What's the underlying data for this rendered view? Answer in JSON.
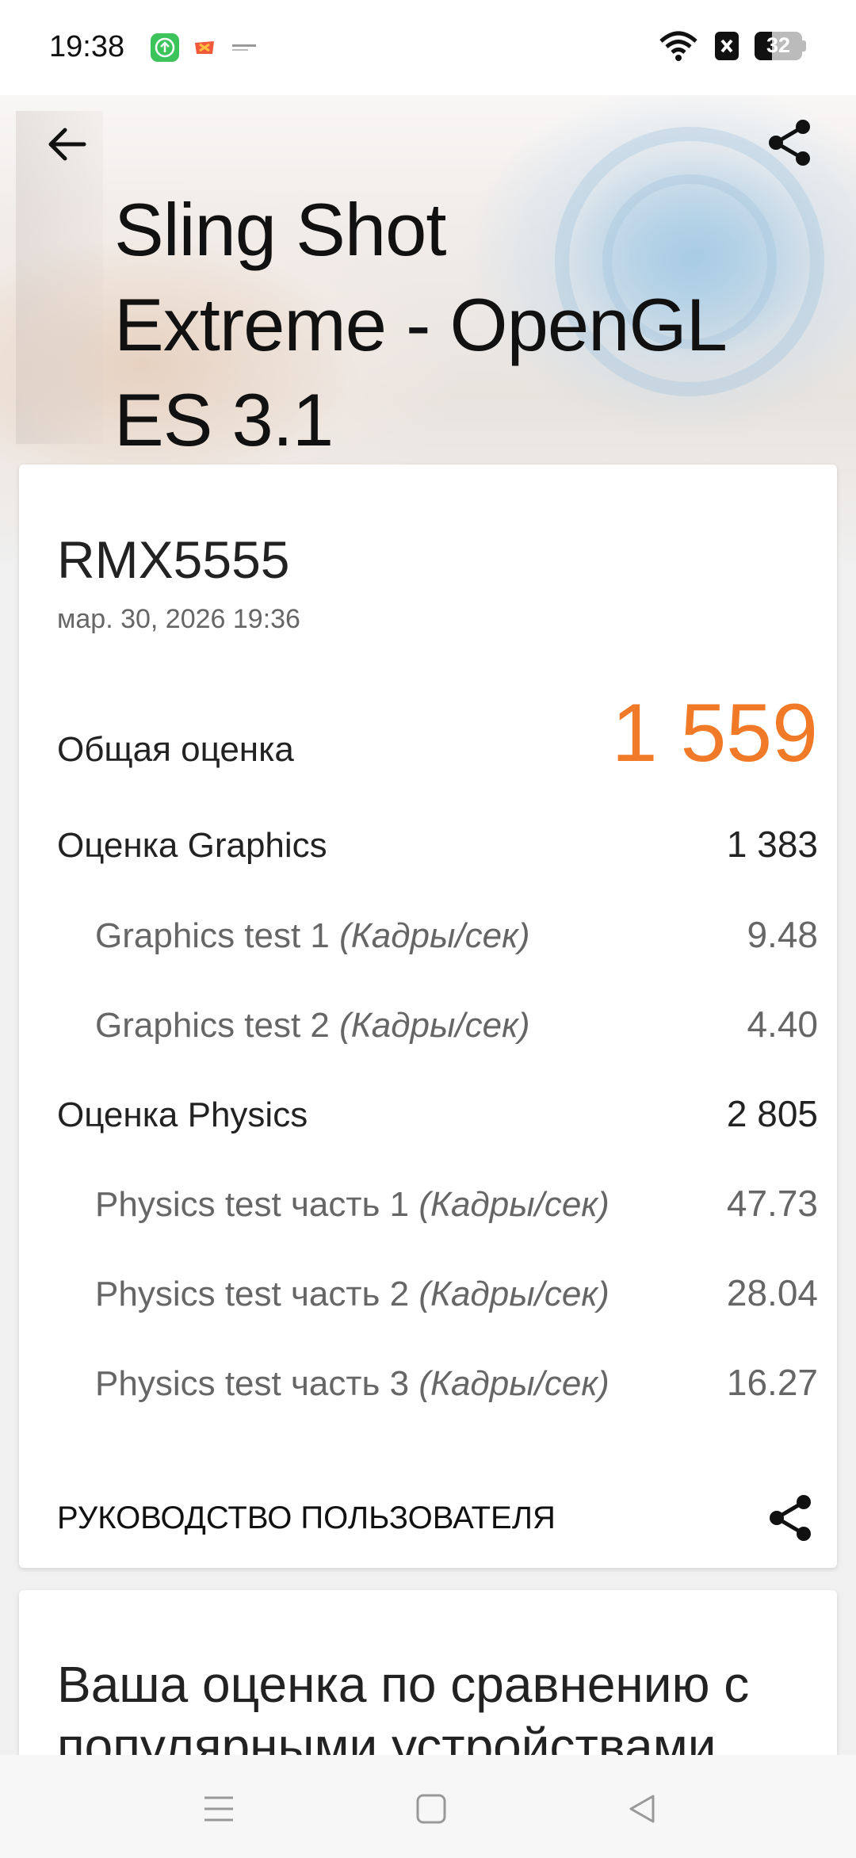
{
  "status_bar": {
    "time": "19:38",
    "battery": "32"
  },
  "header": {
    "title_line1": "Sling Shot",
    "title_line2": "Extreme - OpenGL",
    "title_line3": "ES 3.1"
  },
  "result": {
    "device": "RMX5555",
    "date": "мар. 30, 2026 19:36",
    "total_label": "Общая оценка",
    "total_value": "1 559",
    "rows": [
      {
        "label": "Оценка Graphics",
        "unit": "",
        "value": "1 383"
      },
      {
        "label": "Graphics test 1",
        "unit": "(Кадры/сек)",
        "value": "9.48"
      },
      {
        "label": "Graphics test 2",
        "unit": "(Кадры/сек)",
        "value": "4.40"
      },
      {
        "label": "Оценка Physics",
        "unit": "",
        "value": "2 805"
      },
      {
        "label": "Physics test часть 1",
        "unit": "(Кадры/сек)",
        "value": "47.73"
      },
      {
        "label": "Physics test часть 2",
        "unit": "(Кадры/сек)",
        "value": "28.04"
      },
      {
        "label": "Physics test часть 3",
        "unit": "(Кадры/сек)",
        "value": "16.27"
      }
    ],
    "guide_label": "РУКОВОДСТВО ПОЛЬЗОВАТЕЛЯ"
  },
  "comparison": {
    "title": "Ваша оценка по сравнению с популярными устройствами"
  },
  "colors": {
    "accent": "#f07a28",
    "text_primary": "#222222",
    "text_secondary": "#666666"
  },
  "icons": {
    "back": "arrow-left-icon",
    "share": "share-icon",
    "nav_menu": "menu-icon",
    "nav_home": "square-icon",
    "nav_back": "triangle-back-icon"
  }
}
